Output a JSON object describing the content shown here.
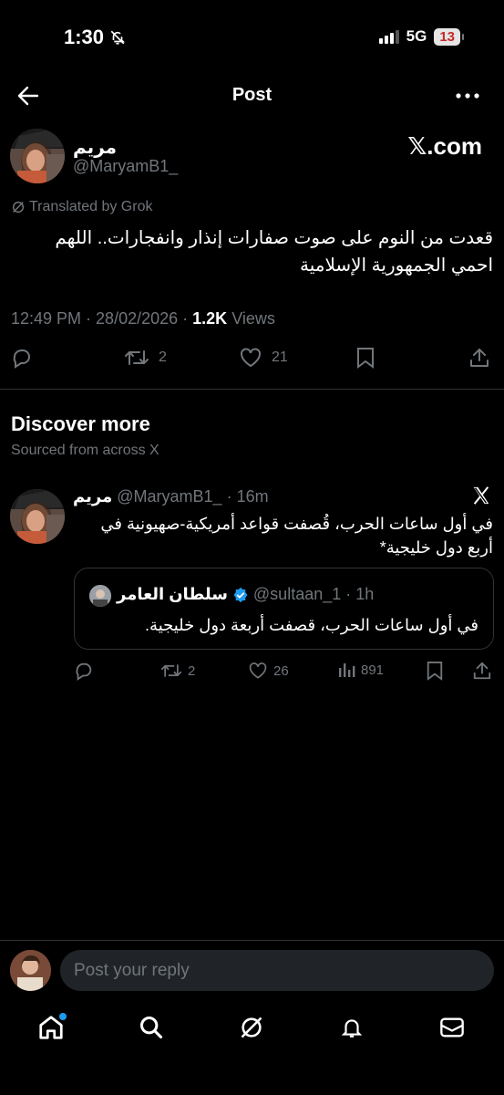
{
  "status_bar": {
    "time": "1:30",
    "network": "5G",
    "battery": "13"
  },
  "header": {
    "title": "Post"
  },
  "post": {
    "author_name": "مريم",
    "handle": "@MaryamB1_",
    "watermark": "𝕏.com",
    "translated_label": "Translated by Grok",
    "text_line1": "قعدت من النوم على صوت صفارات إنذار وانفجارات.. اللهم",
    "text_line2": "احمي الجمهورية الإسلامية",
    "time": "12:49 PM",
    "date": "28/02/2026",
    "views_count": "1.2K",
    "views_label": "Views",
    "reposts": "2",
    "likes": "21"
  },
  "discover": {
    "title": "Discover more",
    "subtitle": "Sourced from across X"
  },
  "related_post": {
    "author_name": "مريم",
    "handle": "@MaryamB1_",
    "age": "16m",
    "text_line1": "في أول ساعات الحرب، قُصفت قواعد أمريكية-صهيونية في",
    "text_line2": "أربع دول خليجية*",
    "reposts": "2",
    "likes": "26",
    "views": "891",
    "quote": {
      "author_name": "سلطان العامر",
      "handle": "@sultaan_1",
      "age": "1h",
      "text": "في أول ساعات الحرب، قصفت أربعة دول خليجية."
    }
  },
  "reply": {
    "placeholder": "Post your reply"
  },
  "colors": {
    "accent": "#1d9bf0",
    "muted": "#71767b",
    "background": "#000000"
  },
  "icons": [
    "back-arrow-icon",
    "more-icon",
    "reply-icon",
    "repost-icon",
    "like-icon",
    "bookmark-icon",
    "share-icon",
    "x-logo-icon",
    "verified-icon",
    "views-icon",
    "home-icon",
    "search-icon",
    "grok-icon",
    "notifications-icon",
    "messages-icon"
  ]
}
